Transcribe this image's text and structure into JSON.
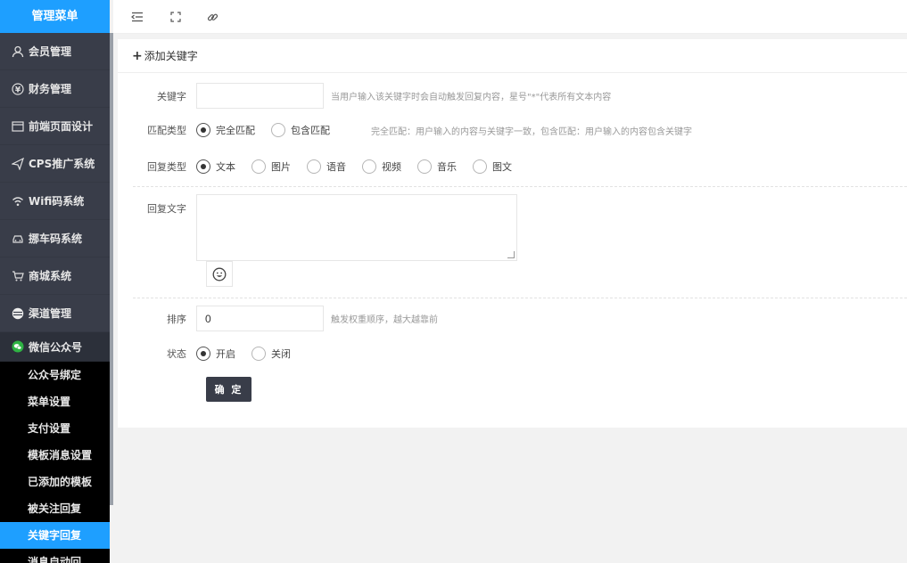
{
  "sidebar": {
    "title": "管理菜单",
    "items": [
      {
        "label": "会员管理",
        "icon": "user-icon"
      },
      {
        "label": "财务管理",
        "icon": "yen-icon"
      },
      {
        "label": "前端页面设计",
        "icon": "layout-icon"
      },
      {
        "label": "CPS推广系统",
        "icon": "send-icon"
      },
      {
        "label": "Wifi码系统",
        "icon": "wifi-icon"
      },
      {
        "label": "挪车码系统",
        "icon": "car-icon"
      },
      {
        "label": "商城系统",
        "icon": "cart-icon"
      },
      {
        "label": "渠道管理",
        "icon": "channel-icon"
      },
      {
        "label": "微信公众号",
        "icon": "wechat-icon"
      }
    ],
    "sub_items": [
      {
        "label": "公众号绑定"
      },
      {
        "label": "菜单设置"
      },
      {
        "label": "支付设置"
      },
      {
        "label": "模板消息设置"
      },
      {
        "label": "已添加的模板"
      },
      {
        "label": "被关注回复"
      },
      {
        "label": "关键字回复"
      },
      {
        "label": "消息自动回"
      }
    ]
  },
  "topbar": {
    "icons": [
      "menu-fold-icon",
      "fullscreen-icon",
      "link-icon"
    ]
  },
  "form": {
    "title": "添加关键字",
    "keyword": {
      "label": "关键字",
      "value": "",
      "hint": "当用户输入该关键字时会自动触发回复内容，星号\"*\"代表所有文本内容"
    },
    "match_type": {
      "label": "匹配类型",
      "options": [
        "完全匹配",
        "包含匹配"
      ],
      "selected": "完全匹配",
      "hint": "完全匹配：用户输入的内容与关键字一致，包含匹配：用户输入的内容包含关键字"
    },
    "reply_type": {
      "label": "回复类型",
      "options": [
        "文本",
        "图片",
        "语音",
        "视频",
        "音乐",
        "图文"
      ],
      "selected": "文本"
    },
    "reply_text": {
      "label": "回复文字",
      "value": ""
    },
    "sort": {
      "label": "排序",
      "value": "0",
      "hint": "触发权重顺序，越大越靠前"
    },
    "status": {
      "label": "状态",
      "options": [
        "开启",
        "关闭"
      ],
      "selected": "开启"
    },
    "submit_label": "确 定"
  },
  "colors": {
    "accent": "#1e9fff",
    "sidebar_bg": "#393d49",
    "sub_bg": "#000000"
  }
}
